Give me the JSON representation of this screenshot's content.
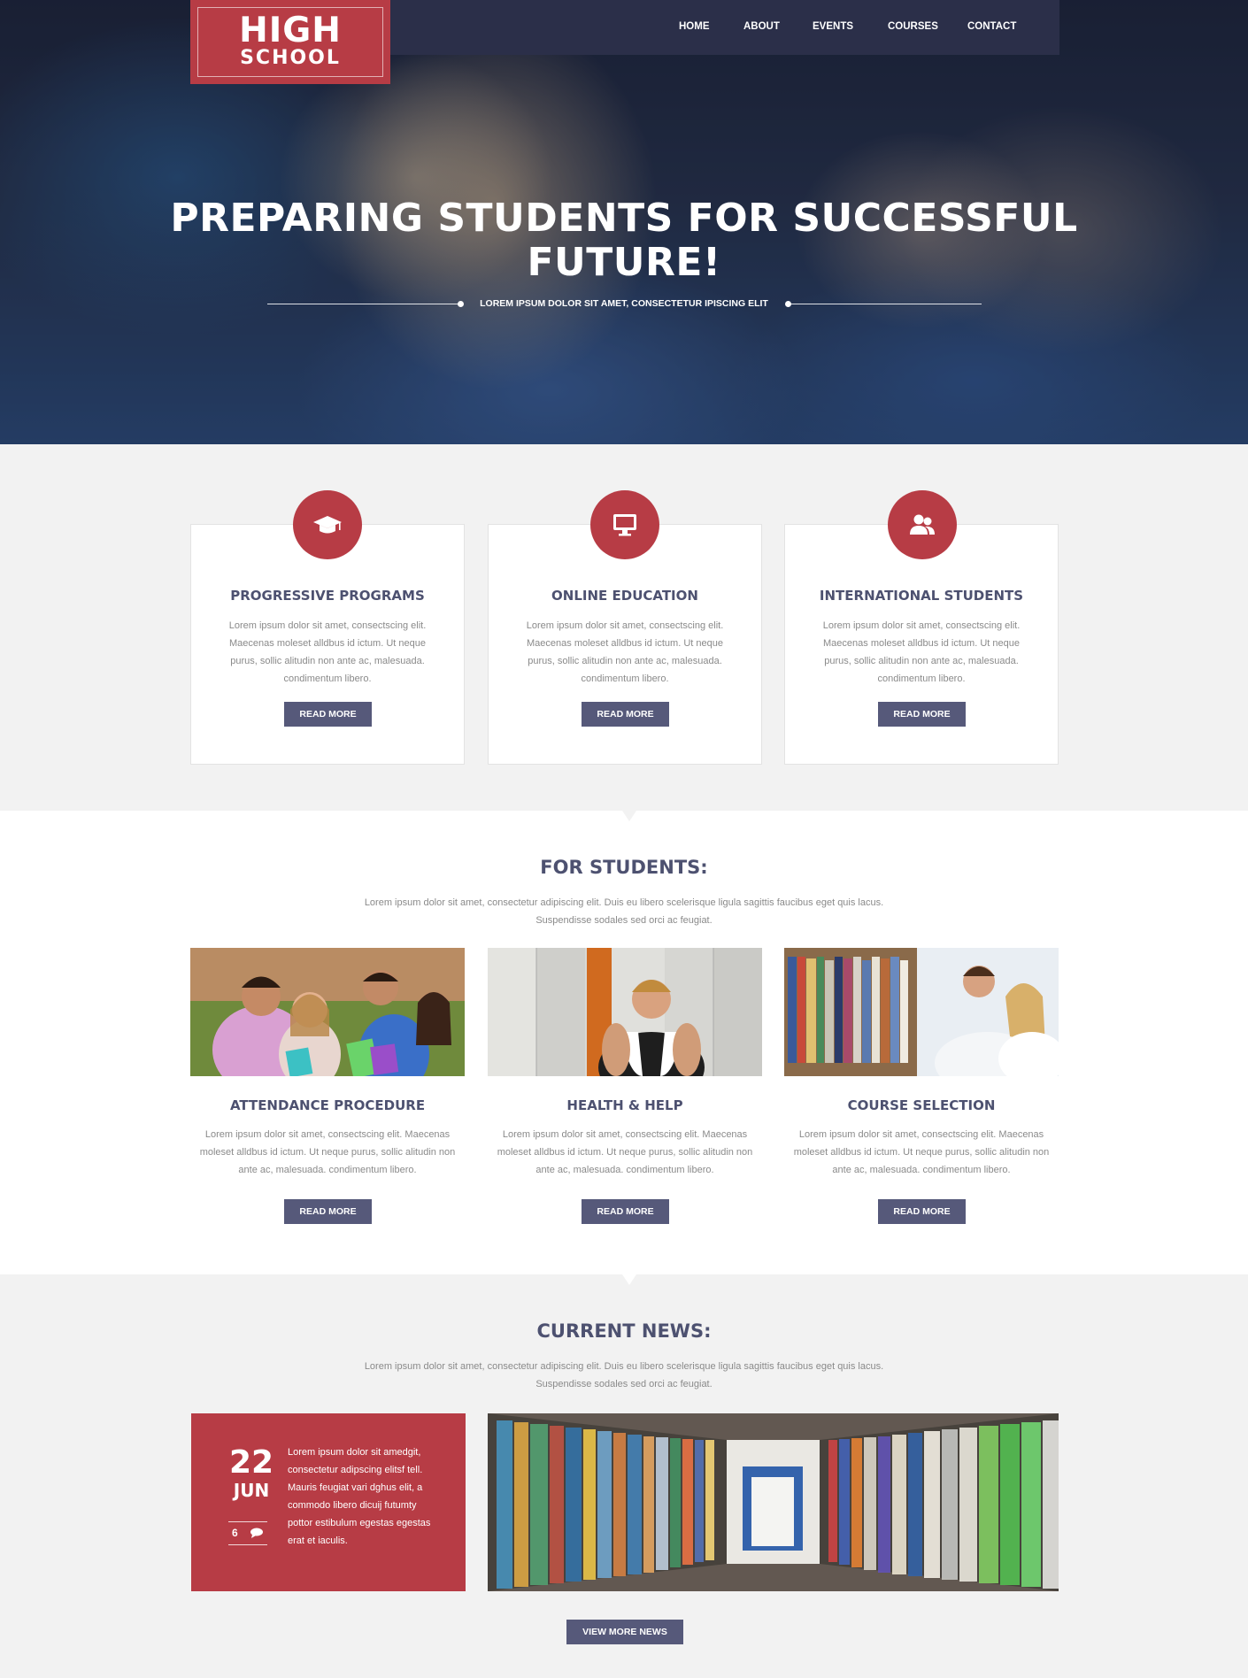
{
  "brand": {
    "line1": "HIGH",
    "line2": "SCHOOL"
  },
  "nav": {
    "items": [
      "HOME",
      "ABOUT",
      "EVENTS",
      "COURSES",
      "CONTACT"
    ]
  },
  "hero": {
    "title_line1": "PREPARING STUDENTS FOR SUCCESSFUL",
    "title_line2": "FUTURE!",
    "subtitle": "LOREM IPSUM DOLOR SIT AMET, CONSECTETUR IPISCING ELIT"
  },
  "features": [
    {
      "icon": "graduation-cap-icon",
      "title": "PROGRESSIVE PROGRAMS",
      "text": "Lorem ipsum dolor sit amet, consectscing elit. Maecenas moleset alldbus id ictum. Ut neque purus, sollic alitudin non ante ac, malesuada. condimentum libero.",
      "button": "READ MORE"
    },
    {
      "icon": "monitor-icon",
      "title": "ONLINE EDUCATION",
      "text": "Lorem ipsum dolor sit amet, consectscing elit. Maecenas moleset alldbus id ictum. Ut neque purus, sollic alitudin non ante ac, malesuada. condimentum libero.",
      "button": "READ MORE"
    },
    {
      "icon": "users-icon",
      "title": "INTERNATIONAL STUDENTS",
      "text": "Lorem ipsum dolor sit amet, consectscing elit. Maecenas moleset alldbus id ictum. Ut neque purus, sollic alitudin non ante ac, malesuada. condimentum libero.",
      "button": "READ MORE"
    }
  ],
  "students": {
    "title": "FOR STUDENTS:",
    "intro_line1": "Lorem ipsum dolor sit amet, consectetur adipiscing elit. Duis eu libero scelerisque ligula sagittis faucibus eget quis lacus.",
    "intro_line2": "Suspendisse sodales sed orci ac feugiat.",
    "items": [
      {
        "title": "ATTENDANCE PROCEDURE",
        "text": "Lorem ipsum dolor sit amet, consectscing elit. Maecenas moleset alldbus id ictum. Ut neque purus, sollic alitudin non ante ac, malesuada. condimentum libero.",
        "button": "READ MORE"
      },
      {
        "title": "HEALTH & HELP",
        "text": "Lorem ipsum dolor sit amet, consectscing elit. Maecenas moleset alldbus id ictum. Ut neque purus, sollic alitudin non ante ac, malesuada. condimentum libero.",
        "button": "READ MORE"
      },
      {
        "title": "COURSE SELECTION",
        "text": "Lorem ipsum dolor sit amet, consectscing elit. Maecenas moleset alldbus id ictum. Ut neque purus, sollic alitudin non ante ac, malesuada. condimentum libero.",
        "button": "READ MORE"
      }
    ]
  },
  "news": {
    "title": "CURRENT NEWS:",
    "intro_line1": "Lorem ipsum dolor sit amet, consectetur adipiscing elit. Duis eu libero scelerisque ligula sagittis faucibus eget quis lacus.",
    "intro_line2": "Suspendisse sodales sed orci ac feugiat.",
    "item": {
      "day": "22",
      "month": "JUN",
      "comments": "6",
      "text": "Lorem ipsum dolor sit amedgit, consectetur adipscing elitsf tell. Mauris feugiat vari dghus elit, a commodo libero dicuij futumty pottor estibulum  egestas egestas erat et iaculis."
    },
    "button": "VIEW MORE NEWS"
  },
  "colors": {
    "accent": "#b73c45",
    "nav": "#2b2f49",
    "button": "#56597a",
    "heading": "#4d5170"
  }
}
